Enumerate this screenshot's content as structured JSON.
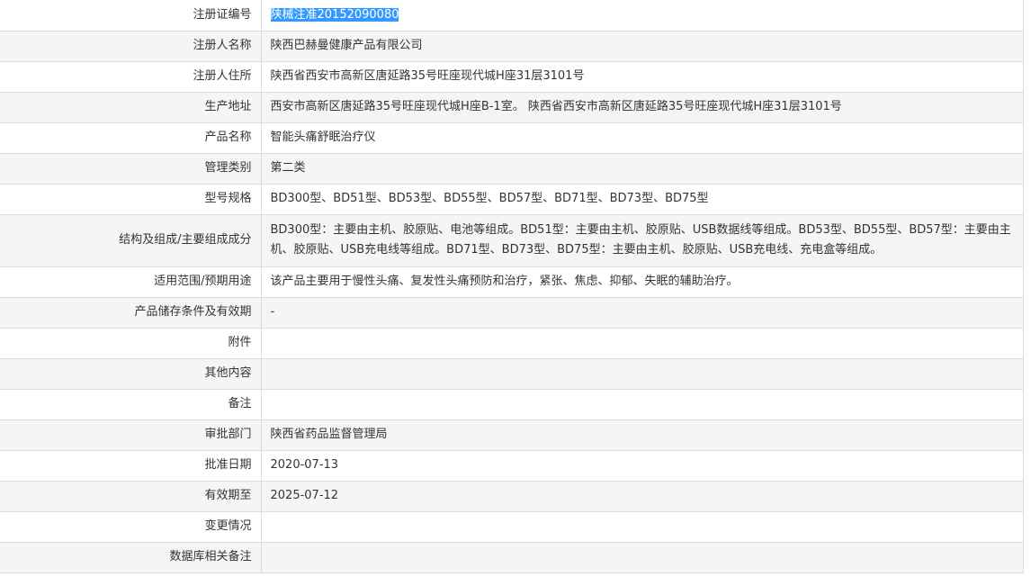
{
  "rows": [
    {
      "label": "注册证编号",
      "value": "陕械注准20152090080"
    },
    {
      "label": "注册人名称",
      "value": "陕西巴赫曼健康产品有限公司"
    },
    {
      "label": "注册人住所",
      "value": "陕西省西安市高新区唐延路35号旺座现代城H座31层3101号"
    },
    {
      "label": "生产地址",
      "value": "西安市高新区唐延路35号旺座现代城H座B-1室。 陕西省西安市高新区唐延路35号旺座现代城H座31层3101号"
    },
    {
      "label": "产品名称",
      "value": "智能头痛舒眠治疗仪"
    },
    {
      "label": "管理类别",
      "value": "第二类"
    },
    {
      "label": "型号规格",
      "value": "BD300型、BD51型、BD53型、BD55型、BD57型、BD71型、BD73型、BD75型"
    },
    {
      "label": "结构及组成/主要组成成分",
      "value": "BD300型：主要由主机、胶原贴、电池等组成。BD51型：主要由主机、胶原贴、USB数据线等组成。BD53型、BD55型、BD57型：主要由主机、胶原贴、USB充电线等组成。BD71型、BD73型、BD75型：主要由主机、胶原贴、USB充电线、充电盒等组成。"
    },
    {
      "label": "适用范围/预期用途",
      "value": "该产品主要用于慢性头痛、复发性头痛预防和治疗，紧张、焦虑、抑郁、失眠的辅助治疗。"
    },
    {
      "label": "产品储存条件及有效期",
      "value": "-"
    },
    {
      "label": "附件",
      "value": ""
    },
    {
      "label": "其他内容",
      "value": ""
    },
    {
      "label": "备注",
      "value": ""
    },
    {
      "label": "审批部门",
      "value": "陕西省药品监督管理局"
    },
    {
      "label": "批准日期",
      "value": "2020-07-13"
    },
    {
      "label": "有效期至",
      "value": "2025-07-12"
    },
    {
      "label": "变更情况",
      "value": ""
    },
    {
      "label": "数据库相关备注",
      "value": ""
    }
  ],
  "colors": {
    "label_bg": "#f4f5f7",
    "border": "#dcdcdc",
    "selection": "#3399ff"
  }
}
